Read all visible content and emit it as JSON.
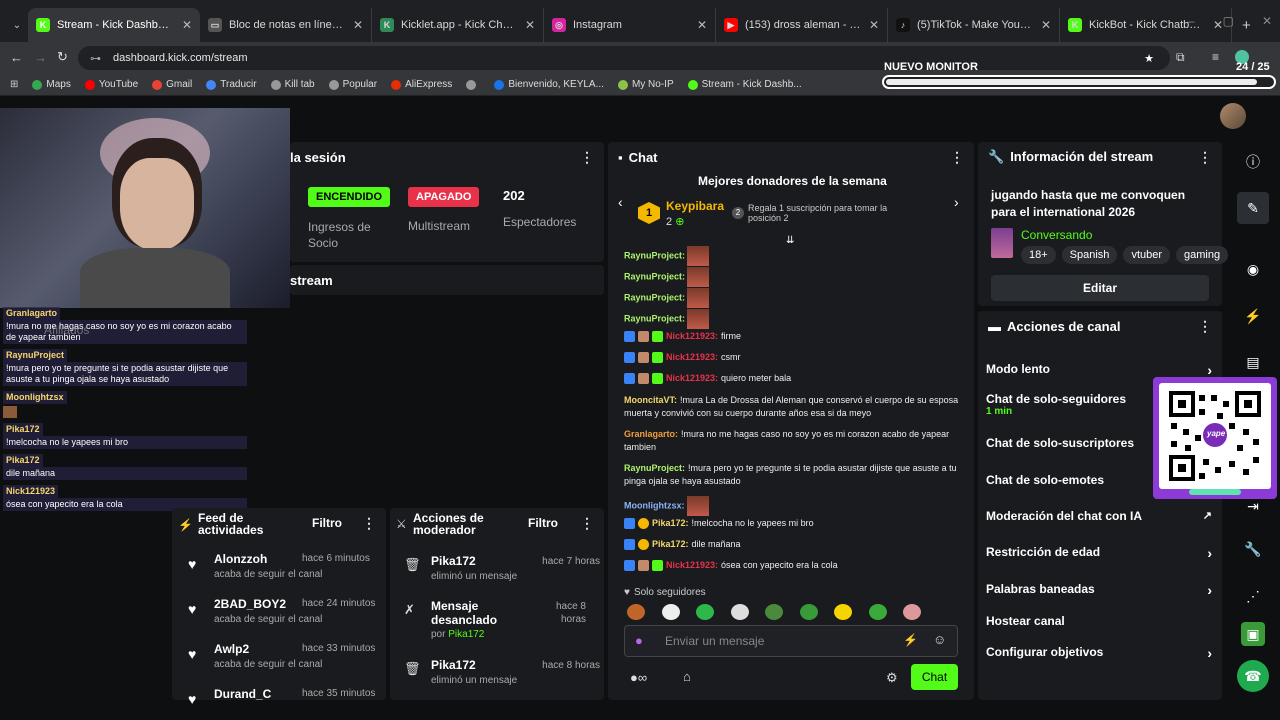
{
  "browser": {
    "tabs": [
      {
        "title": "Stream - Kick Dashboard",
        "color": "#53fc18",
        "glyph": "K",
        "active": true
      },
      {
        "title": "Bloc de notas en línea - Toma y...",
        "color": "#555",
        "glyph": "▭",
        "active": false
      },
      {
        "title": "Kicklet.app - Kick Chatbot and L...",
        "color": "#2e8b57",
        "glyph": "K",
        "active": false
      },
      {
        "title": "Instagram",
        "color": "#d6249f",
        "glyph": "◎",
        "active": false
      },
      {
        "title": "(153) dross aleman - YouTube",
        "color": "#ff0000",
        "glyph": "▶",
        "active": false
      },
      {
        "title": "(5)TikTok - Make Your Day",
        "color": "#111",
        "glyph": "♪",
        "active": false
      },
      {
        "title": "KickBot - Kick Chatbot, Alerts, T...",
        "color": "#53fc18",
        "glyph": "K",
        "active": false
      }
    ],
    "url": "dashboard.kick.com/stream",
    "bookmarks": [
      {
        "label": "Maps",
        "color": "#34a853"
      },
      {
        "label": "YouTube",
        "color": "#ff0000"
      },
      {
        "label": "Gmail",
        "color": "#ea4335"
      },
      {
        "label": "Traducir",
        "color": "#4285f4"
      },
      {
        "label": "Kill tab",
        "color": "#999"
      },
      {
        "label": "Popular",
        "color": "#999"
      },
      {
        "label": "AliExpress",
        "color": "#e62e04"
      },
      {
        "label": "",
        "color": "#999"
      },
      {
        "label": "Bienvenido, KEYLA...",
        "color": "#1a73e8"
      },
      {
        "label": "My No-IP",
        "color": "#8bc34a"
      },
      {
        "label": "Stream - Kick Dashb...",
        "color": "#53fc18"
      }
    ]
  },
  "goal": {
    "title": "NUEVO MONITOR",
    "count": "24",
    "total": "/ 25",
    "progress": 0.96
  },
  "session": {
    "title": "la sesión",
    "encendido": "ENCENDIDO",
    "apagado": "APAGADO",
    "viewers": "202",
    "viewers_label": "Espectadores",
    "ingresos": "Ingresos de Socio",
    "multistream": "Multistream",
    "stream_label": "stream"
  },
  "overlay_chat": [
    {
      "user": "Granlagarto",
      "msg": "!mura no me hagas caso no soy yo es mi corazon acabo de yapear tambien",
      "color": "#f5d76e"
    },
    {
      "user": "RaynuProject",
      "msg": "!mura pero yo te pregunte si te podia asustar dijiste que asuste a tu pinga ojala se haya asustado",
      "color": "#f5d76e"
    },
    {
      "user": "Moonlightzsx",
      "msg": "",
      "color": "#f5d76e"
    },
    {
      "user": "Pika172",
      "msg": "!melcocha no le yapees mi bro",
      "color": "#f5d76e"
    },
    {
      "user": "Pika172",
      "msg": "dile mañana",
      "color": "#f5d76e"
    },
    {
      "user": "Nick121923",
      "msg": "ósea con yapecito era la cola",
      "color": "#f5d76e"
    }
  ],
  "overlay_extra": "Afiliados",
  "activity": {
    "title": "Feed de actividades",
    "filter": "Filtro",
    "items": [
      {
        "user": "Alonzzoh",
        "time": "hace 6 minutos",
        "action": "acaba de seguir el canal"
      },
      {
        "user": "2BAD_BOY2",
        "time": "hace 24 minutos",
        "action": "acaba de seguir el canal"
      },
      {
        "user": "Awlp2",
        "time": "hace 33 minutos",
        "action": "acaba de seguir el canal"
      },
      {
        "user": "Durand_C",
        "time": "hace 35 minutos",
        "action": ""
      }
    ]
  },
  "mod": {
    "title": "Acciones de moderador",
    "filter": "Filtro",
    "items": [
      {
        "user": "Pika172",
        "time": "hace 7 horas",
        "action": "eliminó un mensaje",
        "by": ""
      },
      {
        "user": "Mensaje desanclado",
        "time": "hace 8 horas",
        "action": "por ",
        "by": "Pika172"
      },
      {
        "user": "Pika172",
        "time": "hace 8 horas",
        "action": "eliminó un mensaje",
        "by": ""
      }
    ]
  },
  "chat": {
    "title": "Chat",
    "donors_title": "Mejores donadores de la semana",
    "top_donor": "Keypibara",
    "top_count": "2",
    "rank1": "1",
    "rank2": "2",
    "promo": "Regala 1 suscripción para tomar la posición 2",
    "messages": [
      {
        "user": "RaynuProject:",
        "msg": "",
        "ucolor": "#aef26a",
        "emote": true
      },
      {
        "user": "RaynuProject:",
        "msg": "",
        "ucolor": "#aef26a",
        "emote": true
      },
      {
        "user": "RaynuProject:",
        "msg": "",
        "ucolor": "#aef26a",
        "emote": true
      },
      {
        "user": "RaynuProject:",
        "msg": "",
        "ucolor": "#aef26a",
        "emote": true
      },
      {
        "user": "Nick121923:",
        "msg": "firme",
        "ucolor": "#e8324a",
        "emote": false
      },
      {
        "user": "Nick121923:",
        "msg": "csmr",
        "ucolor": "#e8324a",
        "emote": false
      },
      {
        "user": "Nick121923:",
        "msg": "quiero meter bala",
        "ucolor": "#e8324a",
        "emote": false
      },
      {
        "user": "MooncitaVT:",
        "msg": "!mura La de Drossa del Aleman que conservó el cuerpo de su esposa muerta y convivió con su cuerpo durante años esa si da meyo",
        "ucolor": "#f5d76e",
        "emote": false
      },
      {
        "user": "Granlagarto:",
        "msg": "!mura no me hagas caso no soy yo es mi corazon acabo de yapear tambien",
        "ucolor": "#f39c3c",
        "emote": false
      },
      {
        "user": "RaynuProject:",
        "msg": "!mura pero yo te pregunte si te podia asustar dijiste que asuste a tu pinga ojala se haya asustado",
        "ucolor": "#aef26a",
        "emote": false
      },
      {
        "user": "Moonlightzsx:",
        "msg": "",
        "ucolor": "#8ab4f8",
        "emote": true
      },
      {
        "user": "Pika172:",
        "msg": "!melcocha no le yapees mi bro",
        "ucolor": "#f5d76e",
        "emote": false
      },
      {
        "user": "Pika172:",
        "msg": "dile mañana",
        "ucolor": "#f5d76e",
        "emote": false
      },
      {
        "user": "Nick121923:",
        "msg": "ósea con yapecito era la cola",
        "ucolor": "#e8324a",
        "emote": false
      }
    ],
    "followers_only": "Solo seguidores",
    "placeholder": "Enviar un mensaje",
    "send": "Chat"
  },
  "info": {
    "title": "Información del stream",
    "stream_title": "jugando hasta que me convoquen para el international 2026",
    "category": "Conversando",
    "tags": [
      "18+",
      "Spanish",
      "vtuber",
      "gaming"
    ],
    "edit": "Editar"
  },
  "actions": {
    "title": "Acciones de canal",
    "items": [
      {
        "label": "Modo lento",
        "sub": ""
      },
      {
        "label": "Chat de solo-seguidores",
        "sub": "1 min"
      },
      {
        "label": "Chat de solo-suscriptores",
        "sub": ""
      },
      {
        "label": "Chat de solo-emotes",
        "sub": ""
      },
      {
        "label": "Moderación del chat con IA",
        "sub": ""
      },
      {
        "label": "Restricción de edad",
        "sub": ""
      },
      {
        "label": "Palabras baneadas",
        "sub": ""
      },
      {
        "label": "Hostear canal",
        "sub": ""
      },
      {
        "label": "Configurar objetivos",
        "sub": ""
      }
    ]
  },
  "qr": {
    "caption": "yape"
  },
  "colors": {
    "accent": "#53fc18",
    "panel": "#191b1f",
    "bg": "#0e0f11",
    "red": "#e8324a"
  }
}
